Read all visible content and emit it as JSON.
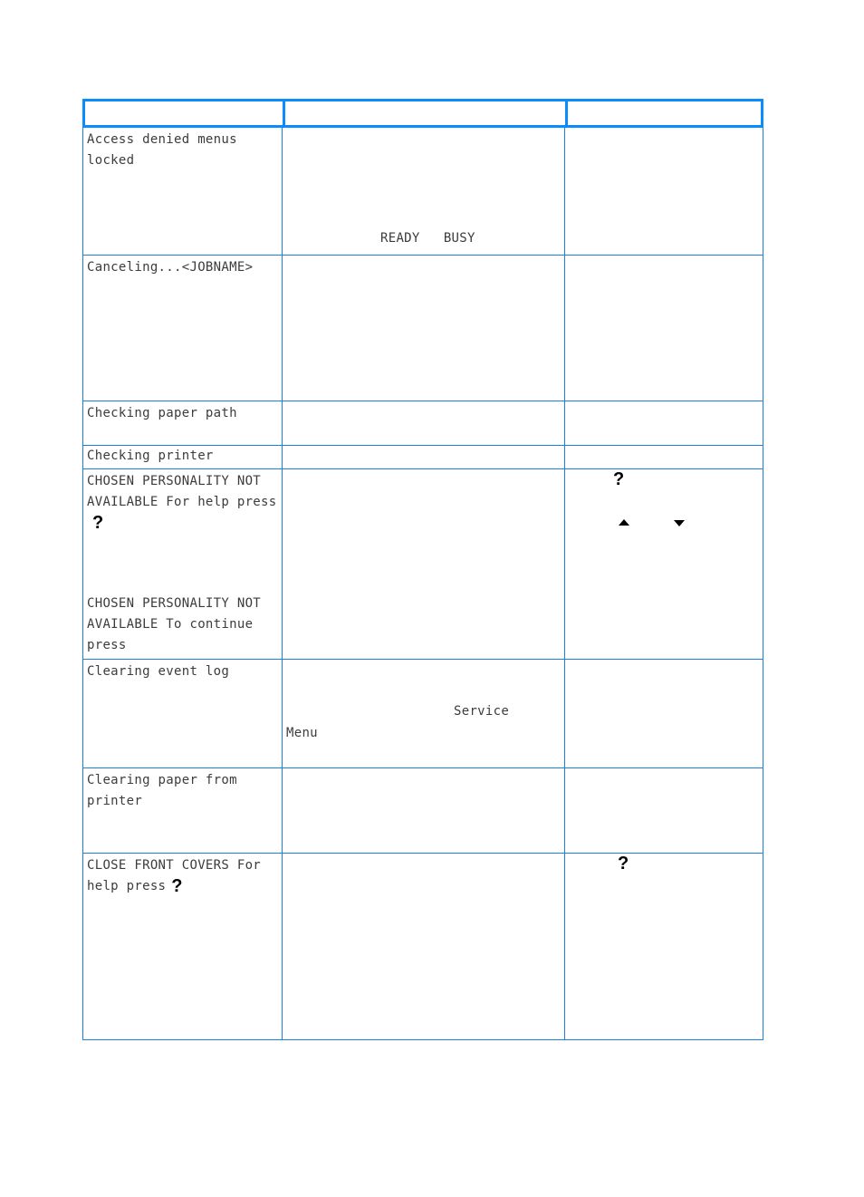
{
  "table": {
    "header": [
      "",
      "",
      ""
    ],
    "rows": [
      {
        "message": "Access denied menus locked",
        "description_fragment": "READY   BUSY",
        "action": ""
      },
      {
        "message": "Canceling...<JOBNAME>",
        "description_fragment": "",
        "action": ""
      },
      {
        "message": "Checking paper path",
        "description_fragment": "",
        "action": ""
      },
      {
        "message": "Checking printer",
        "description_fragment": "",
        "action": ""
      },
      {
        "message": "CHOSEN PERSONALITY NOT AVAILABLE For help press",
        "message_icon": "help-question-icon",
        "message_alt": "CHOSEN PERSONALITY NOT AVAILABLE To continue press",
        "description_fragment": "",
        "action_icons": [
          "help-question-icon",
          "up-arrow-icon",
          "down-arrow-icon"
        ]
      },
      {
        "message": "Clearing event log",
        "description_fragment_1": "Service",
        "description_fragment_2": "Menu",
        "action": ""
      },
      {
        "message": "Clearing paper from printer",
        "description_fragment": "",
        "action": ""
      },
      {
        "message": "CLOSE FRONT COVERS For help press",
        "message_icon": "help-question-icon",
        "description_fragment": "",
        "action_icons": [
          "help-question-icon"
        ]
      }
    ]
  },
  "glyphs": {
    "question": "?"
  },
  "colors": {
    "header_border": "#0a8cff",
    "grid_line": "#1a80e0"
  }
}
